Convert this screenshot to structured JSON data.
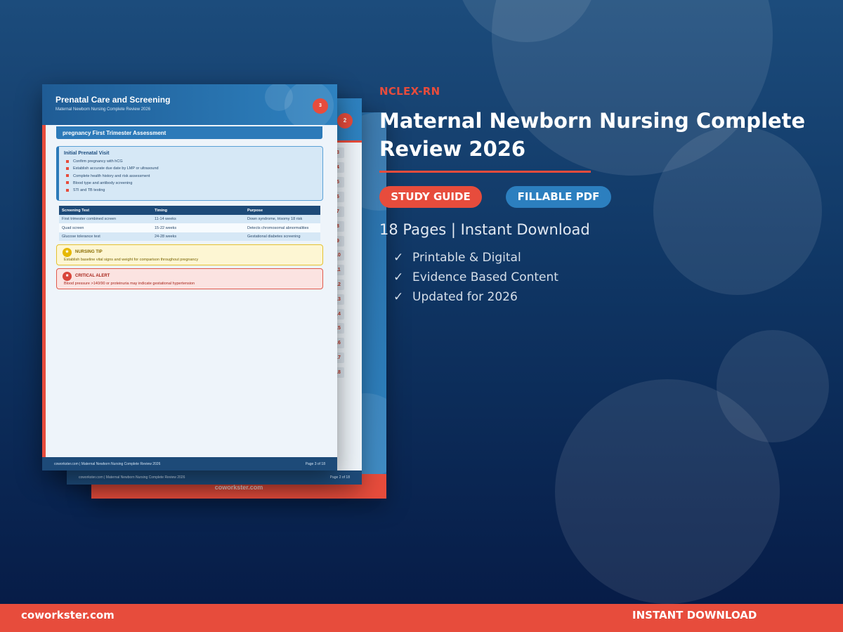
{
  "hero": {
    "exam": "NCLEX-RN",
    "title": "Maternal Newborn Nursing Complete Review 2026",
    "badges": [
      "STUDY GUIDE",
      "FILLABLE PDF"
    ],
    "meta": "18 Pages | Instant Download",
    "features": [
      "Printable & Digital",
      "Evidence Based Content",
      "Updated for 2026"
    ],
    "check_icon": "✓"
  },
  "footer": {
    "site": "coworkster.com",
    "cta": "INSTANT DOWNLOAD"
  },
  "preview": {
    "back_page": {
      "footer": "coworkster.com"
    },
    "middle_page": {
      "badge": "2",
      "toc_numbers": [
        "3",
        "4",
        "5",
        "6",
        "7",
        "8",
        "9",
        "10",
        "11",
        "12",
        "13",
        "14",
        "15",
        "16",
        "17",
        "18"
      ],
      "footer_left": "coworkster.com  |  Maternal Newborn Nursing Complete Review 2026",
      "footer_right": "Page 2 of 18"
    },
    "front_page": {
      "title": "Prenatal Care and Screening",
      "subtitle": "Maternal Newborn Nursing Complete Review 2026",
      "badge": "3",
      "section": "pregnancy  First Trimester Assessment",
      "visit_title": "Initial Prenatal Visit",
      "visit_items": [
        "Confirm pregnancy with hCG",
        "Establish accurate due date by LMP or ultrasound",
        "Complete health history and risk assessment",
        "Blood type and antibody screening",
        "STI and TB testing"
      ],
      "table": {
        "headers": [
          "Screening Test",
          "Timing",
          "Purpose"
        ],
        "rows": [
          [
            "First trimester combined screen",
            "11-14 weeks",
            "Down syndrome, trisomy 18 risk"
          ],
          [
            "Quad screen",
            "15-22 weeks",
            "Detects chromosomal abnormalities"
          ],
          [
            "Glucose tolerance test",
            "24-28 weeks",
            "Gestational diabetes screening"
          ]
        ]
      },
      "tip": {
        "title": "NURSING TIP",
        "text": "Establish baseline vital signs and weight for comparison throughout pregnancy",
        "icon": "★"
      },
      "alert": {
        "title": "CRITICAL ALERT",
        "text": "Blood pressure >140/90 or proteinuria may indicate gestational hypertension",
        "icon": "■"
      },
      "footer_left": "coworkster.com  |  Maternal Newborn Nursing Complete Review 2026",
      "footer_right": "Page 3 of 18"
    }
  },
  "colors": {
    "accent": "#e74c3c",
    "blue": "#2c7fbf",
    "navy": "#0f3563"
  }
}
